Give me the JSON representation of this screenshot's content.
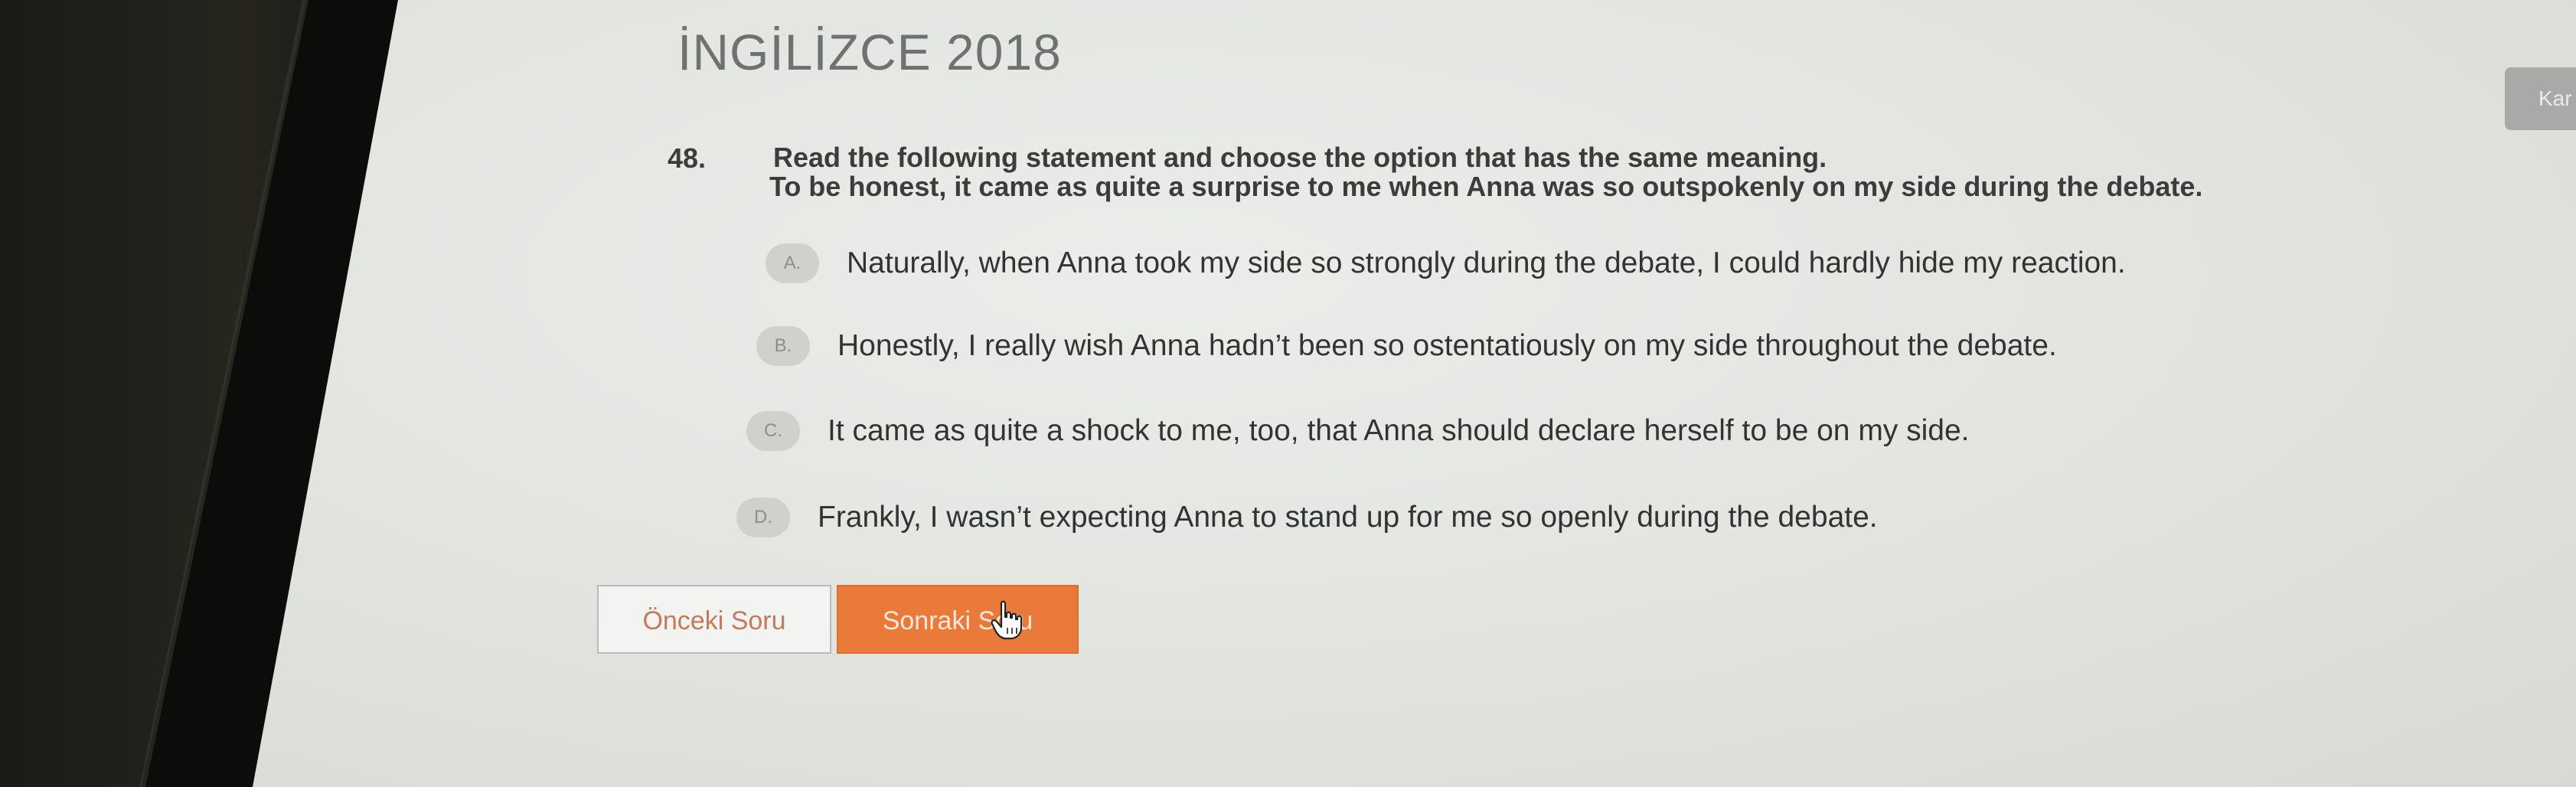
{
  "exam": {
    "title": "İNGİLİZCE 2018"
  },
  "side_tab": {
    "label": "Kar"
  },
  "question": {
    "number": "48.",
    "prompt": "Read the following statement and choose the option that has the same meaning.",
    "statement": "To be honest, it came as quite a surprise to me when Anna was so outspokenly on my side during the debate."
  },
  "options": [
    {
      "letter": "A.",
      "text": "Naturally, when Anna took my side so strongly during the debate, I could hardly hide my reaction."
    },
    {
      "letter": "B.",
      "text": "Honestly, I really wish Anna hadn’t been so ostentatiously on my side throughout the debate."
    },
    {
      "letter": "C.",
      "text": "It came as quite a shock to me, too, that Anna should declare herself to be on my side."
    },
    {
      "letter": "D.",
      "text": "Frankly, I wasn’t expecting Anna to stand up for me so openly during the debate."
    }
  ],
  "nav": {
    "prev_label": "Önceki Soru",
    "next_label": "Sonraki Soru"
  },
  "colors": {
    "accent": "#e97a3a",
    "text": "#323433",
    "badge": "#cfd1cd"
  },
  "icons": {
    "pointer": "hand-pointer-icon"
  }
}
